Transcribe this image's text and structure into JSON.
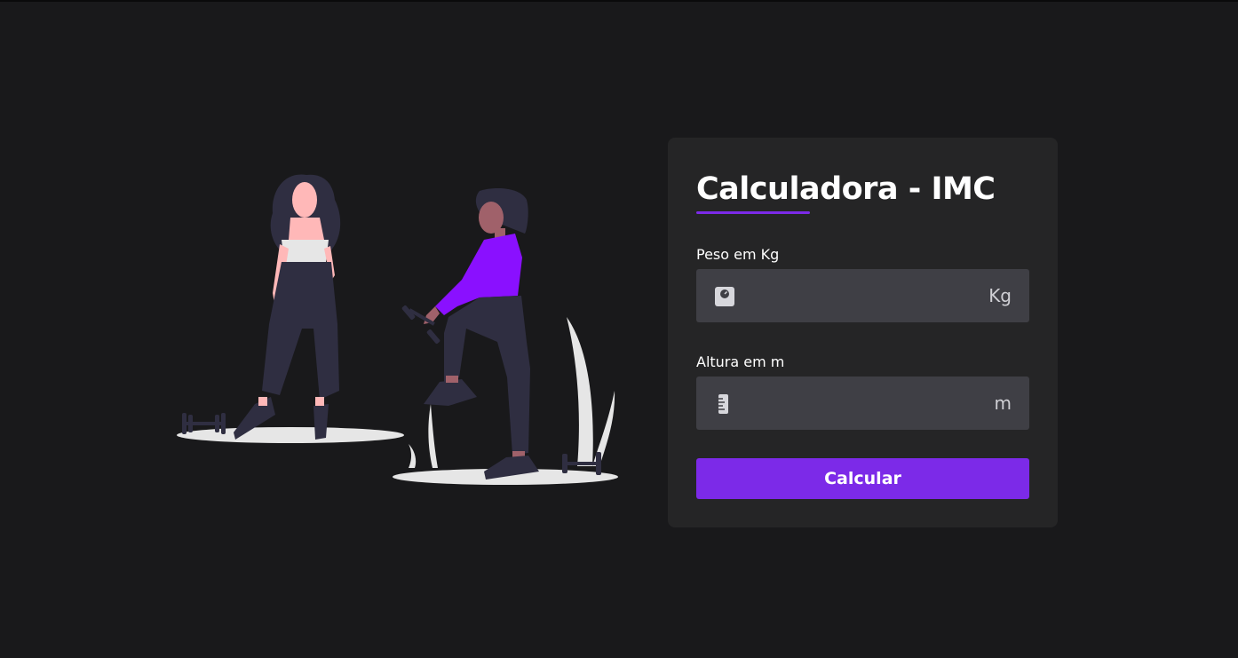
{
  "card": {
    "title": "Calculadora - IMC",
    "peso": {
      "label": "Peso em Kg",
      "value": "",
      "unit": "Kg",
      "icon": "weight-scale-icon"
    },
    "altura": {
      "label": "Altura em m",
      "value": "",
      "unit": "m",
      "icon": "ruler-icon"
    },
    "button_label": "Calcular"
  },
  "colors": {
    "background": "#19191b",
    "card": "#252526",
    "input": "#3f3f45",
    "accent": "#7c2ae8"
  }
}
